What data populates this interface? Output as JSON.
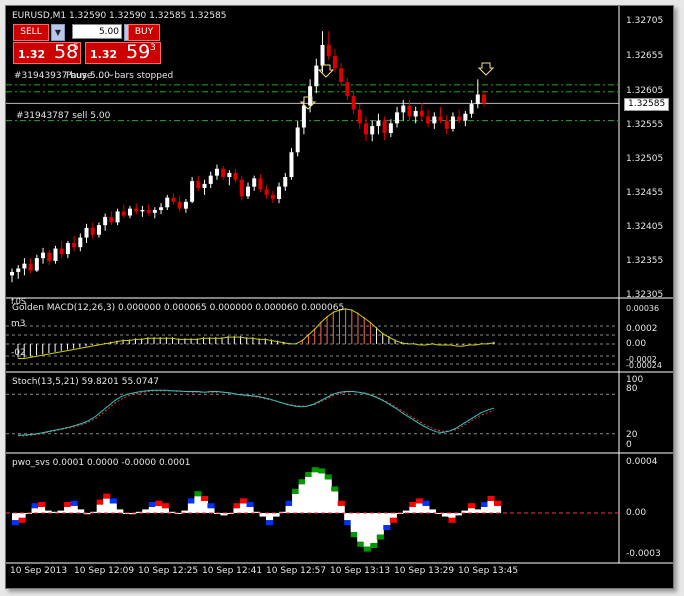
{
  "window": {
    "symbol_info": "EURUSD,M1  1.32590 1.32590 1.32585 1.32585"
  },
  "trade_panel": {
    "sell_label": "SELL",
    "buy_label": "BUY",
    "lot_value": "5.00",
    "bid_small": "1.32",
    "bid_big": "58",
    "bid_tiny": "5",
    "ask_small": "1.32",
    "ask_big": "59",
    "ask_tiny": "3"
  },
  "orders": {
    "buy_line_label": "#31943937 buy 5.00",
    "status_text": "Pause ... ~bars stopped",
    "sell_line_label": "#31943787 sell 5.00"
  },
  "colors": {
    "bull_candle": "#ffffff",
    "bear_candle": "#dd0000",
    "order_line": "#22aa22",
    "macd_signal": "#cccc00",
    "stoch_main": "#2ec8c8",
    "stoch_signal": "#ff3333",
    "pwo_green": "#009900",
    "pwo_blue": "#0033ff",
    "pwo_red": "#ff0000"
  },
  "price_axis": {
    "labels": [
      "1.32705",
      "1.32655",
      "1.32605",
      "1.32555",
      "1.32505",
      "1.32455",
      "1.32405",
      "1.32355",
      "1.32305"
    ],
    "current_price": "1.32585"
  },
  "macd": {
    "title": "Golden MACD(12,26,3) 0.000000 0.000065 0.000000 0.000060 0.000065",
    "left_top": "f.0S",
    "left_mid": "m3",
    "left_bot": "-02",
    "axis_labels": [
      "0.00036",
      "0.0002",
      "0.00",
      "-0.0002",
      "-0.00024"
    ]
  },
  "stoch": {
    "title": "Stoch(13,5,21) 59.8201 55.0747",
    "axis_labels": [
      "100",
      "80",
      "20",
      "0"
    ]
  },
  "pwo": {
    "title": "pwo_svs 0.0001 0.0000 -0.0000 0.0001",
    "axis_labels": [
      "0.0004",
      "0.00",
      "-0.0003"
    ]
  },
  "time_axis": {
    "labels": [
      "10 Sep 2013",
      "10 Sep 12:09",
      "10 Sep 12:25",
      "10 Sep 12:41",
      "10 Sep 12:57",
      "10 Sep 13:13",
      "10 Sep 13:29",
      "10 Sep 13:45"
    ]
  },
  "chart_data": {
    "type": "candlestick",
    "symbol": "EURUSD",
    "timeframe": "M1",
    "ylim": [
      1.32305,
      1.32715
    ],
    "candles": [
      [
        1.32335,
        1.32345,
        1.32325,
        1.3234
      ],
      [
        1.3234,
        1.3235,
        1.3233,
        1.32345
      ],
      [
        1.32345,
        1.3236,
        1.32335,
        1.32352
      ],
      [
        1.32352,
        1.3236,
        1.32338,
        1.32342
      ],
      [
        1.32342,
        1.32365,
        1.3234,
        1.3236
      ],
      [
        1.3236,
        1.32375,
        1.32352,
        1.32368
      ],
      [
        1.32368,
        1.32372,
        1.3235,
        1.32356
      ],
      [
        1.32356,
        1.32378,
        1.32352,
        1.32374
      ],
      [
        1.32374,
        1.32385,
        1.3236,
        1.32366
      ],
      [
        1.32366,
        1.32385,
        1.3236,
        1.32382
      ],
      [
        1.32382,
        1.32392,
        1.3237,
        1.32376
      ],
      [
        1.32376,
        1.32396,
        1.3237,
        1.3239
      ],
      [
        1.3239,
        1.3241,
        1.32382,
        1.32404
      ],
      [
        1.32404,
        1.32412,
        1.32388,
        1.32394
      ],
      [
        1.32394,
        1.32412,
        1.3239,
        1.32408
      ],
      [
        1.32408,
        1.32425,
        1.324,
        1.3242
      ],
      [
        1.3242,
        1.32428,
        1.32408,
        1.32412
      ],
      [
        1.32412,
        1.32432,
        1.32408,
        1.32428
      ],
      [
        1.32428,
        1.32438,
        1.32418,
        1.32422
      ],
      [
        1.32422,
        1.32436,
        1.32418,
        1.32432
      ],
      [
        1.32432,
        1.3244,
        1.32424,
        1.32428
      ],
      [
        1.32428,
        1.32436,
        1.3242,
        1.3243
      ],
      [
        1.3243,
        1.32438,
        1.32422,
        1.32426
      ],
      [
        1.32426,
        1.32434,
        1.32418,
        1.3243
      ],
      [
        1.3243,
        1.3244,
        1.32424,
        1.32434
      ],
      [
        1.32434,
        1.32452,
        1.3243,
        1.32448
      ],
      [
        1.32448,
        1.32454,
        1.32438,
        1.32442
      ],
      [
        1.32442,
        1.3245,
        1.32428,
        1.32432
      ],
      [
        1.32432,
        1.32446,
        1.32426,
        1.32442
      ],
      [
        1.32442,
        1.32478,
        1.3244,
        1.32472
      ],
      [
        1.32472,
        1.3248,
        1.32458,
        1.32462
      ],
      [
        1.32462,
        1.32474,
        1.32452,
        1.32468
      ],
      [
        1.32468,
        1.32486,
        1.32462,
        1.3248
      ],
      [
        1.3248,
        1.32496,
        1.32474,
        1.3249
      ],
      [
        1.3249,
        1.32494,
        1.32474,
        1.32478
      ],
      [
        1.32478,
        1.32488,
        1.32466,
        1.32484
      ],
      [
        1.32484,
        1.3249,
        1.3247,
        1.32474
      ],
      [
        1.32474,
        1.3248,
        1.32444,
        1.3245
      ],
      [
        1.3245,
        1.3247,
        1.32446,
        1.32464
      ],
      [
        1.32464,
        1.3248,
        1.32458,
        1.32476
      ],
      [
        1.32476,
        1.32482,
        1.32456,
        1.3246
      ],
      [
        1.3246,
        1.32466,
        1.32446,
        1.32452
      ],
      [
        1.32452,
        1.32458,
        1.3244,
        1.32446
      ],
      [
        1.32446,
        1.3247,
        1.3244,
        1.32464
      ],
      [
        1.32464,
        1.32484,
        1.32458,
        1.32478
      ],
      [
        1.32478,
        1.3252,
        1.32474,
        1.32514
      ],
      [
        1.32514,
        1.3256,
        1.32508,
        1.3255
      ],
      [
        1.3255,
        1.3259,
        1.3254,
        1.32582
      ],
      [
        1.32582,
        1.3262,
        1.32572,
        1.3261
      ],
      [
        1.3261,
        1.3265,
        1.326,
        1.3264
      ],
      [
        1.3264,
        1.3269,
        1.3263,
        1.3267
      ],
      [
        1.3267,
        1.3269,
        1.32648,
        1.32654
      ],
      [
        1.32654,
        1.32664,
        1.3263,
        1.32636
      ],
      [
        1.32636,
        1.32644,
        1.3261,
        1.32616
      ],
      [
        1.32616,
        1.32622,
        1.3259,
        1.32596
      ],
      [
        1.32596,
        1.32604,
        1.3257,
        1.32576
      ],
      [
        1.32576,
        1.32584,
        1.32548,
        1.32556
      ],
      [
        1.32556,
        1.32566,
        1.3253,
        1.3254
      ],
      [
        1.3254,
        1.3256,
        1.3253,
        1.32552
      ],
      [
        1.32552,
        1.3257,
        1.3254,
        1.3256
      ],
      [
        1.3256,
        1.32566,
        1.32532,
        1.32542
      ],
      [
        1.32542,
        1.32562,
        1.32536,
        1.32556
      ],
      [
        1.32556,
        1.3258,
        1.3255,
        1.32572
      ],
      [
        1.32572,
        1.3259,
        1.3256,
        1.32582
      ],
      [
        1.32582,
        1.3259,
        1.3256,
        1.32566
      ],
      [
        1.32566,
        1.3258,
        1.32556,
        1.32574
      ],
      [
        1.32574,
        1.32586,
        1.3256,
        1.32566
      ],
      [
        1.32566,
        1.32576,
        1.3255,
        1.32556
      ],
      [
        1.32556,
        1.32572,
        1.32548,
        1.32566
      ],
      [
        1.32566,
        1.3258,
        1.32556,
        1.3256
      ],
      [
        1.3256,
        1.32568,
        1.3254,
        1.32548
      ],
      [
        1.32548,
        1.32572,
        1.32544,
        1.32566
      ],
      [
        1.32566,
        1.32576,
        1.32556,
        1.3256
      ],
      [
        1.3256,
        1.32574,
        1.32552,
        1.3257
      ],
      [
        1.3257,
        1.3259,
        1.32564,
        1.32584
      ],
      [
        1.32584,
        1.3262,
        1.32578,
        1.32598
      ],
      [
        1.32598,
        1.32604,
        1.3258,
        1.32585
      ]
    ],
    "macd_hist": [
      -0.00012,
      -0.00012,
      -0.00011,
      -0.0001,
      -9e-05,
      -8e-05,
      -7e-05,
      -6e-05,
      -5e-05,
      -4e-05,
      -3e-05,
      -2e-05,
      -1e-05,
      0,
      1e-05,
      2e-05,
      3e-05,
      4e-05,
      4e-05,
      5e-05,
      5e-05,
      6e-05,
      6e-05,
      6e-05,
      6e-05,
      6e-05,
      5e-05,
      5e-05,
      5e-05,
      5e-05,
      6e-05,
      6e-05,
      6e-05,
      6e-05,
      7e-05,
      7e-05,
      7e-05,
      6e-05,
      6e-05,
      5e-05,
      5e-05,
      4e-05,
      3e-05,
      2e-05,
      1e-05,
      1e-05,
      4e-05,
      9e-05,
      0.00014,
      0.0002,
      0.00025,
      0.00029,
      0.00031,
      0.00032,
      0.00031,
      0.00028,
      0.00024,
      0.0002,
      0.00015,
      0.0001,
      7e-05,
      4e-05,
      2e-05,
      1e-05,
      1e-05,
      0,
      0,
      1e-05,
      0,
      0,
      0,
      -1e-05,
      -1e-05,
      0,
      0,
      1e-05,
      1e-05,
      2e-05
    ],
    "stoch_main": [
      18,
      18,
      19,
      20,
      22,
      24,
      26,
      28,
      30,
      33,
      36,
      40,
      46,
      54,
      62,
      70,
      76,
      80,
      82,
      84,
      85,
      86,
      86,
      86,
      85,
      85,
      84,
      84,
      84,
      83,
      84,
      84,
      83,
      82,
      80,
      79,
      78,
      77,
      75,
      73,
      70,
      67,
      64,
      62,
      61,
      62,
      65,
      70,
      75,
      80,
      83,
      84,
      84,
      83,
      81,
      78,
      74,
      69,
      63,
      57,
      50,
      44,
      38,
      32,
      27,
      23,
      22,
      24,
      28,
      34,
      40,
      46,
      52,
      56,
      59
    ],
    "stoch_signal": [
      17,
      17,
      18,
      19,
      21,
      23,
      25,
      27,
      29,
      31,
      34,
      38,
      43,
      50,
      58,
      66,
      72,
      77,
      80,
      82,
      84,
      85,
      85,
      85,
      85,
      84,
      84,
      83,
      83,
      83,
      83,
      83,
      83,
      81,
      80,
      78,
      77,
      76,
      74,
      72,
      70,
      67,
      65,
      63,
      62,
      62,
      64,
      68,
      73,
      78,
      81,
      83,
      84,
      83,
      82,
      79,
      75,
      70,
      65,
      59,
      53,
      47,
      41,
      35,
      30,
      26,
      24,
      24,
      26,
      31,
      37,
      43,
      48,
      52,
      55
    ],
    "pwo": [
      -6e-05,
      -4e-05,
      0,
      4e-05,
      5e-05,
      2e-05,
      1e-05,
      2e-05,
      5e-05,
      6e-05,
      3e-05,
      -1e-05,
      1e-05,
      7e-05,
      0.00012,
      8e-05,
      3e-05,
      0,
      -1e-05,
      1e-05,
      3e-05,
      5e-05,
      6e-05,
      4e-05,
      1e-05,
      0,
      2e-05,
      8e-05,
      0.00014,
      0.0001,
      4e-05,
      0,
      -2e-05,
      0,
      4e-05,
      8e-05,
      5e-05,
      1e-05,
      -3e-05,
      -6e-05,
      -3e-05,
      1e-05,
      6e-05,
      0.00016,
      0.00024,
      0.0003,
      0.00034,
      0.00033,
      0.00028,
      0.00018,
      6e-05,
      -6e-05,
      -0.00016,
      -0.00024,
      -0.00028,
      -0.00025,
      -0.00018,
      -0.0001,
      -4e-05,
      0,
      2e-05,
      5e-05,
      8e-05,
      6e-05,
      3e-05,
      0,
      -3e-05,
      -4e-05,
      -2e-05,
      2e-05,
      4e-05,
      3e-05,
      5e-05,
      0.0001,
      6e-05
    ]
  }
}
